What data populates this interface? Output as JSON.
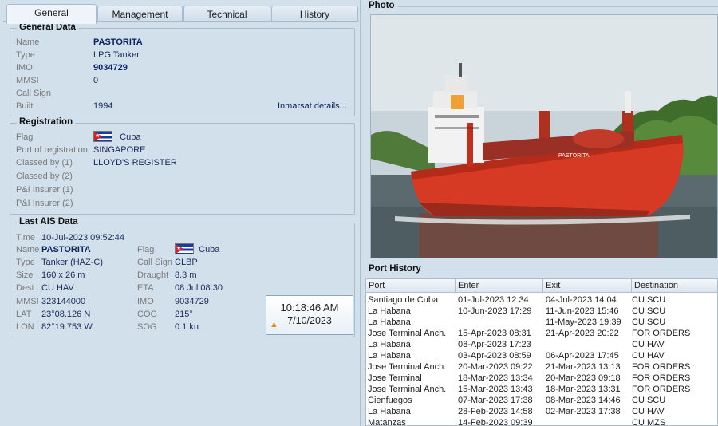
{
  "tabs": [
    "General",
    "Management",
    "Technical",
    "History"
  ],
  "general": {
    "title": "General Data",
    "rows": [
      {
        "label": "Name",
        "value": "PASTORITA"
      },
      {
        "label": "Type",
        "value": "LPG Tanker"
      },
      {
        "label": "IMO",
        "value": "9034729"
      },
      {
        "label": "MMSI",
        "value": "0"
      },
      {
        "label": "Call Sign",
        "value": ""
      },
      {
        "label": "Built",
        "value": "1994"
      }
    ],
    "inmarsat_link": "Inmarsat details..."
  },
  "registration": {
    "title": "Registration",
    "rows": [
      {
        "label": "Flag",
        "value": "Cuba"
      },
      {
        "label": "Port of registration",
        "value": "SINGAPORE"
      },
      {
        "label": "Classed by (1)",
        "value": "LLOYD'S REGISTER"
      },
      {
        "label": "Classed by (2)",
        "value": ""
      },
      {
        "label": "P&I Insurer (1)",
        "value": ""
      },
      {
        "label": "P&I Insurer (2)",
        "value": ""
      }
    ]
  },
  "ais": {
    "title": "Last AIS Data",
    "time_label": "Time",
    "time_value": "10-Jul-2023 09:52:44",
    "left": [
      {
        "label": "Name",
        "value": "PASTORITA"
      },
      {
        "label": "Type",
        "value": "Tanker (HAZ-C)"
      },
      {
        "label": "Size",
        "value": "160 x 26 m"
      },
      {
        "label": "Dest",
        "value": "CU HAV"
      },
      {
        "label": "MMSI",
        "value": "323144000"
      },
      {
        "label": "LAT",
        "value": "23°08.126 N"
      },
      {
        "label": "LON",
        "value": "82°19.753 W"
      }
    ],
    "right": [
      {
        "label": "Flag",
        "value": "Cuba"
      },
      {
        "label": "Call Sign",
        "value": "CLBP"
      },
      {
        "label": "Draught",
        "value": "8.3 m"
      },
      {
        "label": "ETA",
        "value": "08 Jul 08:30"
      },
      {
        "label": "IMO",
        "value": "9034729"
      },
      {
        "label": "COG",
        "value": "215°"
      },
      {
        "label": "SOG",
        "value": "0.1 kn"
      }
    ],
    "clock_time": "10:18:46 AM",
    "clock_date": "7/10/2023"
  },
  "photo": {
    "title": "Photo",
    "hull_name": "PASTORITA"
  },
  "port_history": {
    "title": "Port History",
    "columns": [
      "Port",
      "Enter",
      "Exit",
      "Destination"
    ],
    "rows": [
      [
        "Santiago de Cuba",
        "01-Jul-2023 12:34",
        "04-Jul-2023 14:04",
        "CU SCU"
      ],
      [
        "La Habana",
        "10-Jun-2023 17:29",
        "11-Jun-2023 15:46",
        "CU  SCU"
      ],
      [
        "La Habana",
        "",
        "11-May-2023 19:39",
        "CU  SCU"
      ],
      [
        "Jose Terminal Anch.",
        "15-Apr-2023 08:31",
        "21-Apr-2023 20:22",
        "FOR  ORDERS"
      ],
      [
        "La Habana",
        "08-Apr-2023 17:23",
        "",
        "CU HAV"
      ],
      [
        "La Habana",
        "03-Apr-2023 08:59",
        "06-Apr-2023 17:45",
        "CU HAV"
      ],
      [
        "Jose Terminal Anch.",
        "20-Mar-2023 09:22",
        "21-Mar-2023 13:13",
        "FOR ORDERS"
      ],
      [
        "Jose Terminal",
        "18-Mar-2023 13:34",
        "20-Mar-2023 09:18",
        "FOR ORDERS"
      ],
      [
        "Jose Terminal Anch.",
        "15-Mar-2023 13:43",
        "18-Mar-2023 13:31",
        "FOR ORDERS"
      ],
      [
        "Cienfuegos",
        "07-Mar-2023 17:38",
        "08-Mar-2023 14:46",
        "CU SCU"
      ],
      [
        "La Habana",
        "28-Feb-2023 14:58",
        "02-Mar-2023 17:38",
        "CU HAV"
      ],
      [
        "Matanzas",
        "14-Feb-2023 09:39",
        "",
        "CU MZS"
      ]
    ]
  }
}
